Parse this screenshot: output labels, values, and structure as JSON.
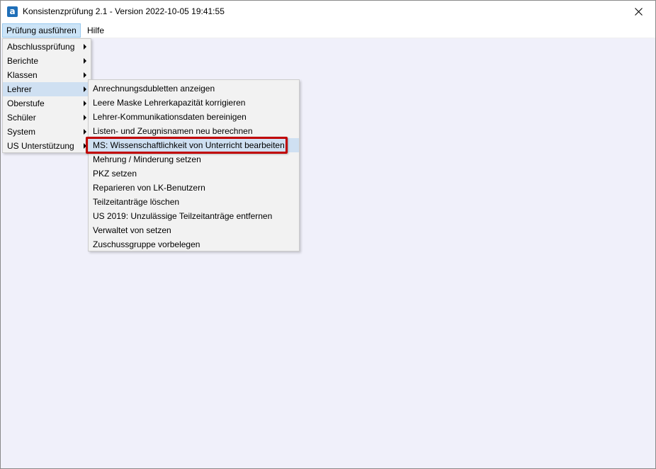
{
  "window": {
    "title": "Konsistenzprüfung 2.1 - Version 2022-10-05 19:41:55",
    "app_icon_glyph": "a",
    "accent_color": "#1f6fb8"
  },
  "menubar": {
    "items": [
      {
        "label": "Prüfung ausführen",
        "state": "open"
      },
      {
        "label": "Hilfe"
      }
    ]
  },
  "main_menu": {
    "items": [
      {
        "label": "Abschlussprüfung",
        "has_submenu": true
      },
      {
        "label": "Berichte",
        "has_submenu": true
      },
      {
        "label": "Klassen",
        "has_submenu": true
      },
      {
        "label": "Lehrer",
        "has_submenu": true,
        "state": "selected"
      },
      {
        "label": "Oberstufe",
        "has_submenu": true
      },
      {
        "label": "Schüler",
        "has_submenu": true
      },
      {
        "label": "System",
        "has_submenu": true
      },
      {
        "label": "US Unterstützung",
        "has_submenu": true
      }
    ]
  },
  "lehrer_submenu": {
    "items": [
      {
        "label": "Anrechnungsdubletten anzeigen"
      },
      {
        "label": "Leere Maske Lehrerkapazität korrigieren"
      },
      {
        "label": "Lehrer-Kommunikationsdaten bereinigen"
      },
      {
        "label": "Listen- und Zeugnisnamen neu berechnen"
      },
      {
        "label": "MS: Wissenschaftlichkeit von Unterricht bearbeiten",
        "state": "highlighted",
        "annotation_color": "#c00000"
      },
      {
        "label": "Mehrung / Minderung setzen"
      },
      {
        "label": "PKZ setzen"
      },
      {
        "label": "Reparieren von LK-Benutzern"
      },
      {
        "label": "Teilzeitanträge löschen"
      },
      {
        "label": "US 2019: Unzulässige Teilzeitanträge entfernen"
      },
      {
        "label": "Verwaltet von setzen"
      },
      {
        "label": "Zuschussgruppe vorbelegen"
      }
    ]
  }
}
